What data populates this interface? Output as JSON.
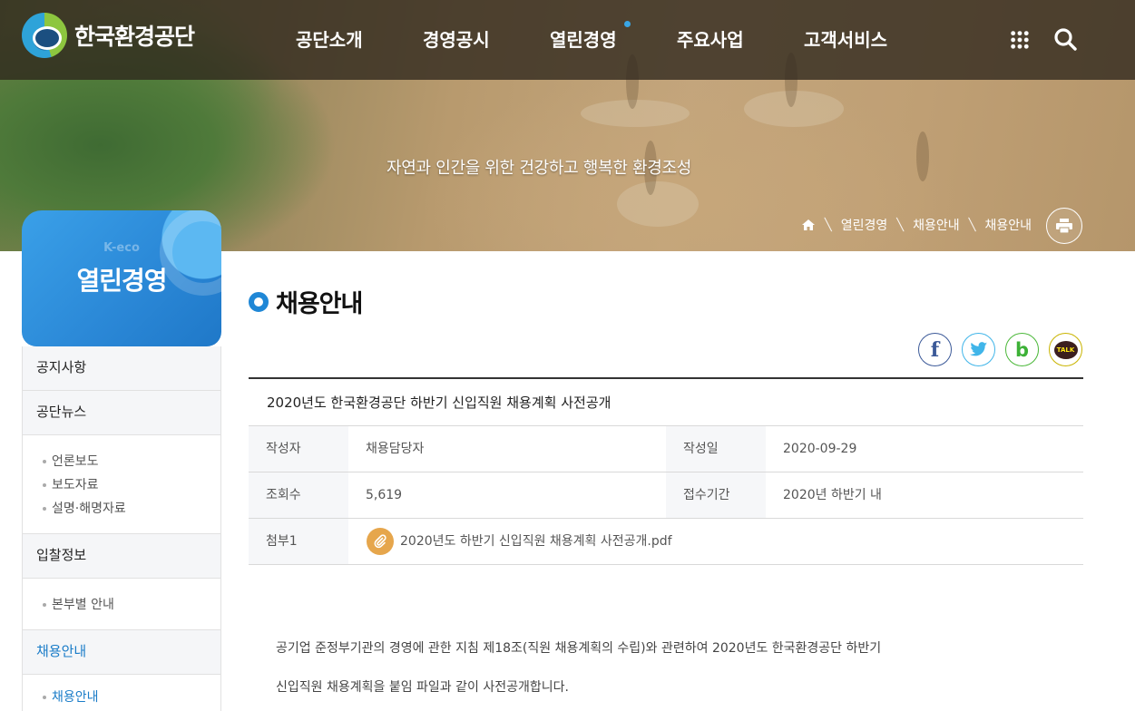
{
  "header": {
    "logo_text": "한국환경공단",
    "nav": [
      {
        "label": "공단소개"
      },
      {
        "label": "경영공시"
      },
      {
        "label": "열린경영"
      },
      {
        "label": "주요사업"
      },
      {
        "label": "고객서비스"
      }
    ],
    "active_nav": "열린경영",
    "icons": [
      "sitemap-grid-icon",
      "search-icon"
    ]
  },
  "hero": {
    "slogan": "자연과 인간을 위한 건강하고 행복한 환경조성",
    "breadcrumb": [
      "열린경영",
      "채용안내",
      "채용안내"
    ]
  },
  "sidebar": {
    "sub_label": "K-eco",
    "title": "열린경영",
    "menu": [
      {
        "label": "공지사항",
        "children": []
      },
      {
        "label": "공단뉴스",
        "children": [
          "언론보도",
          "보도자료",
          "설명·해명자료"
        ]
      },
      {
        "label": "입찰정보",
        "children": [
          "본부별 안내"
        ]
      },
      {
        "label": "채용안내",
        "children": [
          "채용안내"
        ],
        "active": true
      }
    ]
  },
  "content": {
    "page_title": "채용안내",
    "share": [
      "facebook-icon",
      "twitter-icon",
      "band-icon",
      "kakaotalk-icon"
    ],
    "kakao_label": "TALK",
    "post": {
      "subject": "2020년도 한국환경공단 하반기 신입직원 채용계획 사전공개",
      "author_label": "작성자",
      "author": "채용담당자",
      "date_label": "작성일",
      "date": "2020-09-29",
      "views_label": "조회수",
      "views": "5,619",
      "period_label": "접수기간",
      "period": "2020년 하반기 내",
      "attach_label": "첨부1",
      "attachment": "2020년도 하반기 신입직원 채용계획 사전공개.pdf",
      "body": [
        "공기업 준정부기관의 경영에 관한 지침 제18조(직원 채용계획의 수립)와 관련하여 2020년도 한국환경공단 하반기",
        "신입직원 채용계획을 붙임 파일과 같이 사전공개합니다."
      ]
    }
  },
  "colors": {
    "accent": "#1f87d6",
    "header_bg": "#2e261c",
    "attach_icon": "#e6a64c"
  }
}
